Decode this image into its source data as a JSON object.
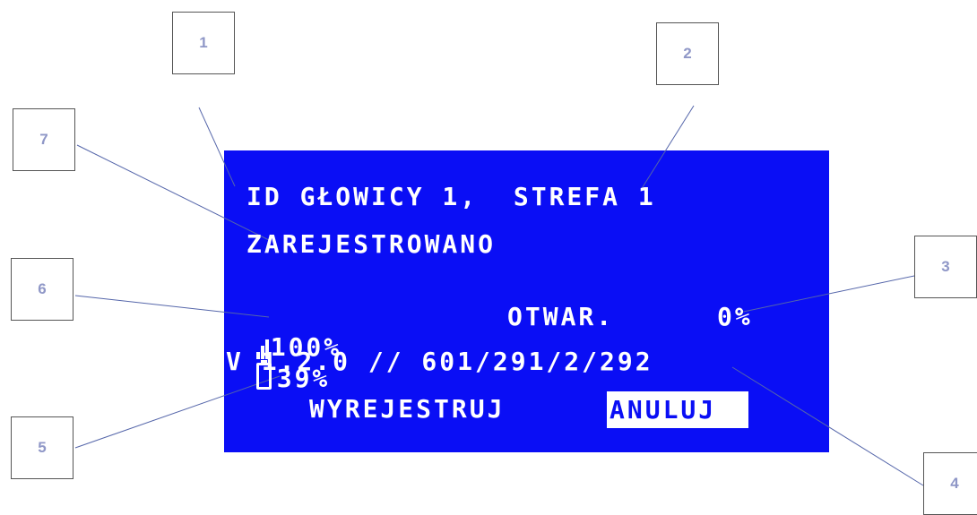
{
  "screen": {
    "line1": "ID GŁOWICY 1,  STREFA 1",
    "line2": "ZAREJESTROWANO",
    "signal_value": "100%",
    "battery_value": "39%",
    "valve_state": "OTWAR.",
    "valve_percent": "0%",
    "version_line": "V 1.2.0 // 601/291/2/292",
    "unregister_button": "WYREJESTRUJ",
    "cancel_button": "ANULUJ"
  },
  "callouts": [
    "1",
    "2",
    "3",
    "4",
    "5",
    "6",
    "7"
  ],
  "colors": {
    "screen_bg": "#0a0ef5",
    "text": "#ffffff",
    "callout_number": "#8f97c7"
  }
}
